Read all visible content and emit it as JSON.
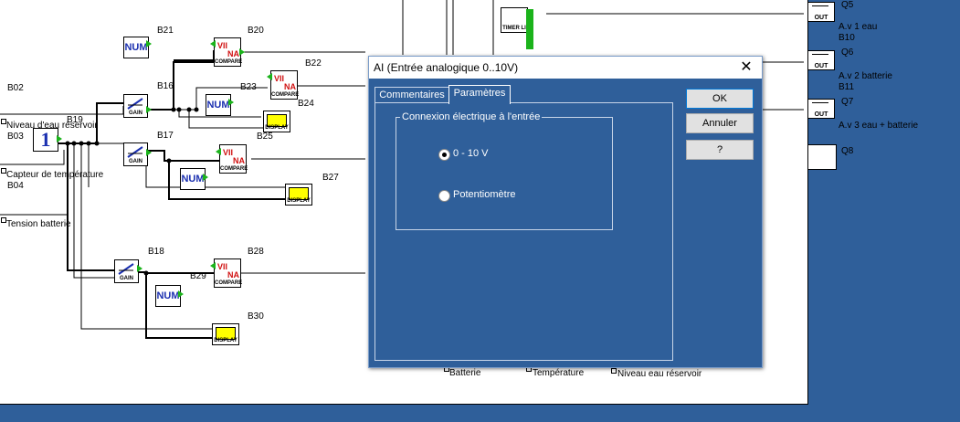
{
  "diagram": {
    "labels": {
      "b21": "B21",
      "b20": "B20",
      "b22": "B22",
      "b16": "B16",
      "b23": "B23",
      "b24": "B24",
      "b02": "B02",
      "b19": "B19",
      "b25": "B25",
      "b03": "B03",
      "b17": "B17",
      "b27": "B27",
      "b04": "B04",
      "b18": "B18",
      "b28": "B28",
      "b29": "B29",
      "b30": "B30"
    },
    "inputs": {
      "niveau": "Niveau d'eau réservoir",
      "capteur": "Capteur de température",
      "tension": "Tension batterie"
    },
    "bottom_labels": {
      "batterie": "Batterie",
      "temperature": "Température",
      "niveau": "Niveau eau réservoir"
    },
    "block_text": {
      "num": "NUM",
      "gain": "GAIN",
      "compare": "COMPARE",
      "display": "DISPLAY",
      "const": "1",
      "out": "OUT",
      "timer": "TIMER LI"
    }
  },
  "outputs": [
    {
      "q": "Q5",
      "label": "A.v 1 eau",
      "b": "B10"
    },
    {
      "q": "Q6",
      "label": "A.v 2 batterie",
      "b": "B11"
    },
    {
      "q": "Q7",
      "label": "A.v 3 eau + batterie",
      "b": ""
    },
    {
      "q": "Q8",
      "label": "",
      "b": ""
    }
  ],
  "dialog": {
    "title": "AI (Entrée analogique 0..10V)",
    "close_glyph": "✕",
    "tabs": [
      "Commentaires",
      "Paramètres"
    ],
    "active_tab": "Paramètres",
    "group_label": "Connexion électrique à l'entrée",
    "options": [
      {
        "label": "0 - 10 V",
        "selected": true
      },
      {
        "label": "Potentiomètre",
        "selected": false
      }
    ],
    "buttons": {
      "ok": "OK",
      "cancel": "Annuler",
      "help": "?"
    }
  },
  "colors": {
    "background": "#2f5f9a",
    "block_text": "#1a2fb0",
    "connector": "#1bb31b",
    "display_screen": "#ffff00"
  }
}
